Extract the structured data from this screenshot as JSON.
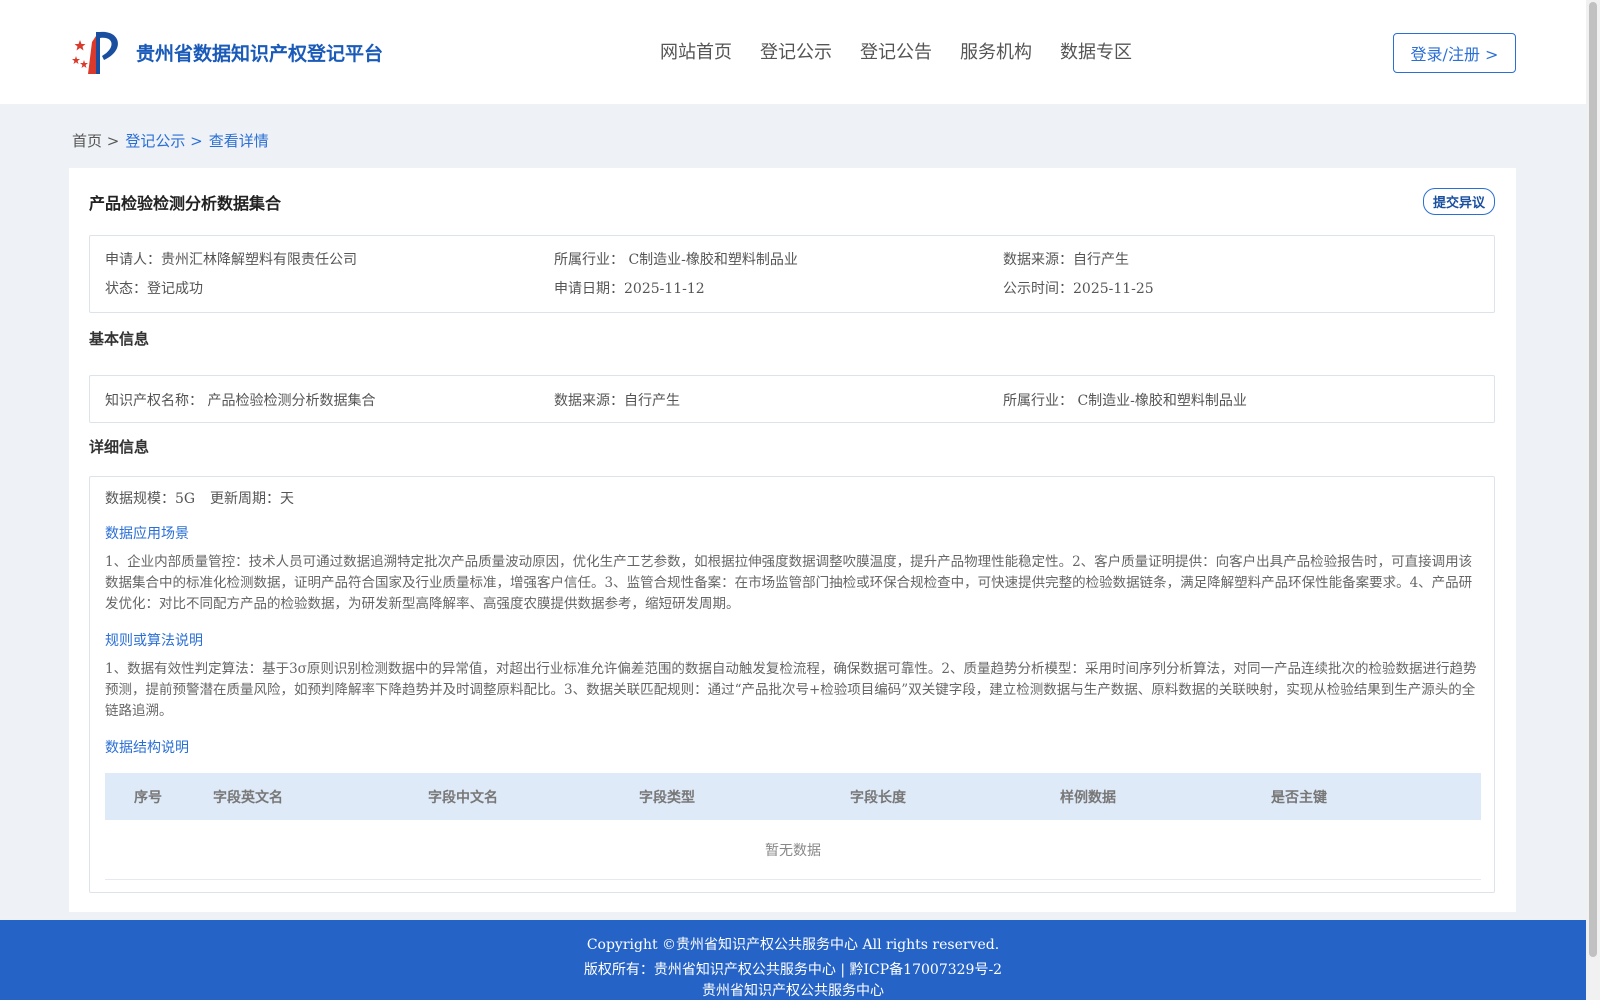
{
  "header": {
    "site_title": "贵州省数据知识产权登记平台",
    "nav": [
      "网站首页",
      "登记公示",
      "登记公告",
      "服务机构",
      "数据专区"
    ],
    "login_label": "登录/注册 >"
  },
  "breadcrumb": [
    "首页 >",
    "登记公示 >",
    "查看详情"
  ],
  "detail": {
    "title": "产品检验检测分析数据集合",
    "objection_label": "提交异议",
    "summary": {
      "applicant": "申请人：贵州汇林降解塑料有限责任公司",
      "industry": "所属行业： C制造业-橡胶和塑料制品业",
      "source": "数据来源：自行产生",
      "status": "状态：登记成功",
      "apply_date": "申请日期：2025-11-12",
      "publish_time": "公示时间：2025-11-25"
    },
    "basic_title": "基本信息",
    "basic": {
      "ip_name": "知识产权名称： 产品检验检测分析数据集合",
      "source": "数据来源：自行产生",
      "industry": "所属行业： C制造业-橡胶和塑料制品业"
    },
    "detail_title": "详细信息",
    "scale": "数据规模：5G",
    "cycle": "更新周期：天",
    "scenario_title": "数据应用场景",
    "scenario_text": "1、企业内部质量管控：技术人员可通过数据追溯特定批次产品质量波动原因，优化生产工艺参数，如根据拉伸强度数据调整吹膜温度，提升产品物理性能稳定性。2、客户质量证明提供：向客户出具产品检验报告时，可直接调用该数据集合中的标准化检测数据，证明产品符合国家及行业质量标准，增强客户信任。3、监管合规性备案：在市场监管部门抽检或环保合规检查中，可快速提供完整的检验数据链条，满足降解塑料产品环保性能备案要求。4、产品研发优化：对比不同配方产品的检验数据，为研发新型高降解率、高强度农膜提供数据参考，缩短研发周期。",
    "rule_title": "规则或算法说明",
    "rule_text": "1、数据有效性判定算法：基于3σ原则识别检测数据中的异常值，对超出行业标准允许偏差范围的数据自动触发复检流程，确保数据可靠性。2、质量趋势分析模型：采用时间序列分析算法，对同一产品连续批次的检验数据进行趋势预测，提前预警潜在质量风险，如预判降解率下降趋势并及时调整原料配比。3、数据关联匹配规则：通过“产品批次号+检验项目编码”双关键字段，建立检测数据与生产数据、原料数据的关联映射，实现从检验结果到生产源头的全链路追溯。",
    "structure_title": "数据结构说明",
    "table_headers": [
      "序号",
      "字段英文名",
      "字段中文名",
      "字段类型",
      "字段长度",
      "样例数据",
      "是否主键"
    ],
    "empty_text": "暂无数据"
  },
  "footer": {
    "copyright": "Copyright ©贵州省知识产权公共服务中心 All rights reserved.",
    "owner": "版权所有：贵州省知识产权公共服务中心 | 黔ICP备17007329号-2",
    "org": "贵州省知识产权公共服务中心"
  },
  "colors": {
    "accent": "#2a6fd6",
    "footer_bg": "#2563c7",
    "table_head_bg": "#dfeaf8"
  }
}
